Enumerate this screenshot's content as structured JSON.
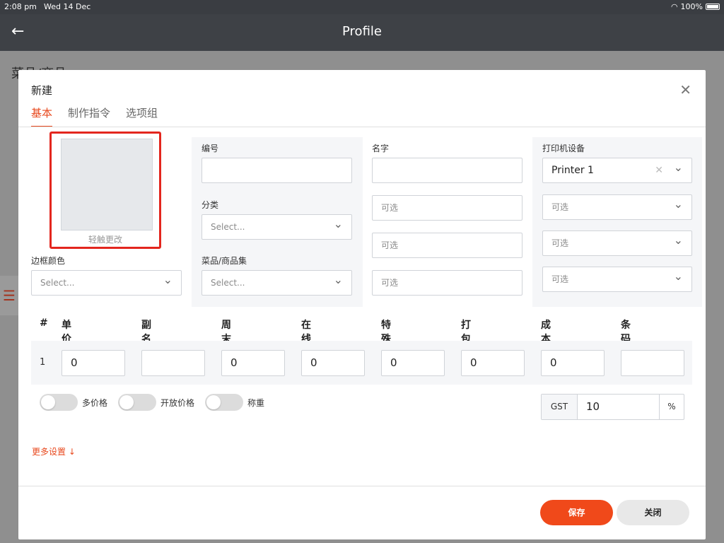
{
  "status_bar": {
    "time": "2:08 pm",
    "date": "Wed 14 Dec",
    "battery": "100%"
  },
  "app_bar": {
    "title": "Profile",
    "back_icon": "arrow-left-icon"
  },
  "background_page": {
    "title": "菜品/商品"
  },
  "modal": {
    "title": "新建",
    "tabs": [
      {
        "label": "基本",
        "active": true
      },
      {
        "label": "制作指令",
        "active": false
      },
      {
        "label": "选项组",
        "active": false
      }
    ],
    "image": {
      "tap_to_change": "轻触更改"
    },
    "border_color": {
      "label": "边框颜色",
      "placeholder": "Select..."
    },
    "code": {
      "label": "编号",
      "value": ""
    },
    "category": {
      "label": "分类",
      "placeholder": "Select..."
    },
    "item_set": {
      "label": "菜品/商品集",
      "placeholder": "Select..."
    },
    "name": {
      "label": "名字",
      "value": "",
      "optional_fields": [
        "可选",
        "可选",
        "可选"
      ]
    },
    "printer": {
      "label": "打印机设备",
      "value": "Printer 1",
      "optional_selects": [
        "可选",
        "可选",
        "可选"
      ]
    },
    "price_table": {
      "headers": [
        "#",
        "单价",
        "副名字",
        "周末价格",
        "在线售价",
        "特殊价格",
        "打包费",
        "成本",
        "条码"
      ],
      "rows": [
        {
          "index": "1",
          "price": "0",
          "sub_name": "",
          "weekend_price": "0",
          "online_price": "0",
          "special_price": "0",
          "packing_fee": "0",
          "cost": "0",
          "barcode": ""
        }
      ]
    },
    "toggles": [
      {
        "label": "多价格",
        "on": false
      },
      {
        "label": "开放价格",
        "on": false
      },
      {
        "label": "称重",
        "on": false
      }
    ],
    "gst": {
      "label": "GST",
      "value": "10",
      "unit": "%"
    },
    "more_settings": "更多设置 ↓",
    "buttons": {
      "save": "保存",
      "close": "关闭"
    }
  },
  "colors": {
    "accent": "#f0491a",
    "highlight_border": "#e3261e"
  }
}
